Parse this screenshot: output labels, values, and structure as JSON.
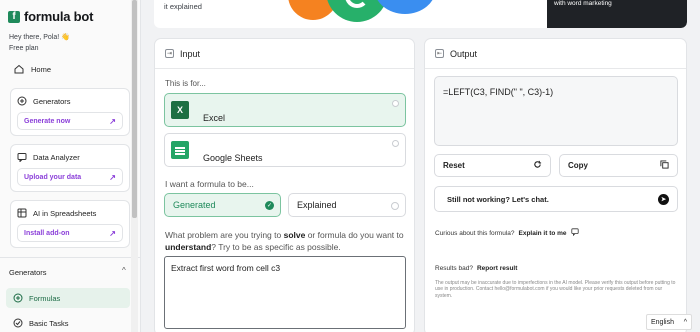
{
  "brand": {
    "name": "formula bot",
    "accent": "#1f8a5b",
    "purple": "#8b3fd9"
  },
  "sidebar": {
    "greeting": "Hey there, Pola! 👋",
    "plan": "Free plan",
    "home": "Home",
    "cards": [
      {
        "title": "Generators",
        "action": "Generate now",
        "icon": "plus-circle-icon"
      },
      {
        "title": "Data Analyzer",
        "action": "Upload your data",
        "icon": "chat-icon"
      },
      {
        "title": "AI in Spreadsheets",
        "action": "Install add-on",
        "icon": "spreadsheet-icon"
      }
    ],
    "section_title": "Generators",
    "items": [
      {
        "label": "Formulas",
        "active": true
      },
      {
        "label": "Basic Tasks",
        "active": false
      }
    ]
  },
  "banner": {
    "text": "it explained",
    "right_text": "with word marketing"
  },
  "input_panel": {
    "title": "Input",
    "for_label": "This is for...",
    "targets": [
      {
        "label": "Excel",
        "selected": true
      },
      {
        "label": "Google Sheets",
        "selected": false
      }
    ],
    "want_label": "I want a formula to be...",
    "modes": [
      {
        "label": "Generated",
        "selected": true
      },
      {
        "label": "Explained",
        "selected": false
      }
    ],
    "problem_prefix": "What problem are you trying to ",
    "problem_solve": "solve",
    "problem_mid": " or formula do you want to ",
    "problem_understand": "understand",
    "problem_suffix": "? Try to be as specific as possible.",
    "textarea_value": "Extract first word from cell c3"
  },
  "output_panel": {
    "title": "Output",
    "formula": "=LEFT(C3, FIND(\" \", C3)-1)",
    "reset_label": "Reset",
    "copy_label": "Copy",
    "still_label": "Still not working? Let's chat.",
    "curious_label": "Curious about this formula?",
    "explain_label": "Explain it to me",
    "results_label": "Results bad?",
    "report_label": "Report result",
    "disclaimer": "The output may be inaccurate due to imperfections in the AI model. Please verify this output before putting to use in production. Contact hello@formulabot.com if you would like your prior requests deleted from our system."
  },
  "language": {
    "selected": "English"
  }
}
